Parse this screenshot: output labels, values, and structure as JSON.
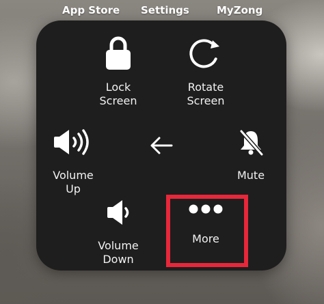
{
  "home_screen": {
    "labels": [
      "App Store",
      "Settings",
      "MyZong"
    ]
  },
  "assistive_touch_menu": {
    "items": [
      {
        "id": "lock_screen",
        "label": "Lock\nScreen",
        "icon": "lock-icon"
      },
      {
        "id": "rotate_screen",
        "label": "Rotate\nScreen",
        "icon": "rotate-icon"
      },
      {
        "id": "volume_up",
        "label": "Volume\nUp",
        "icon": "speaker-loud-icon"
      },
      {
        "id": "back",
        "label": "",
        "icon": "back-arrow-icon"
      },
      {
        "id": "mute",
        "label": "Mute",
        "icon": "bell-slash-icon"
      },
      {
        "id": "volume_down",
        "label": "Volume\nDown",
        "icon": "speaker-soft-icon"
      },
      {
        "id": "more",
        "label": "More",
        "icon": "ellipsis-icon"
      }
    ]
  },
  "annotation": {
    "highlight_target": "more",
    "color": "#e8273a"
  },
  "colors": {
    "panel": "#1e1e1e",
    "icon": "#ffffff",
    "label": "#f2f2f2"
  }
}
